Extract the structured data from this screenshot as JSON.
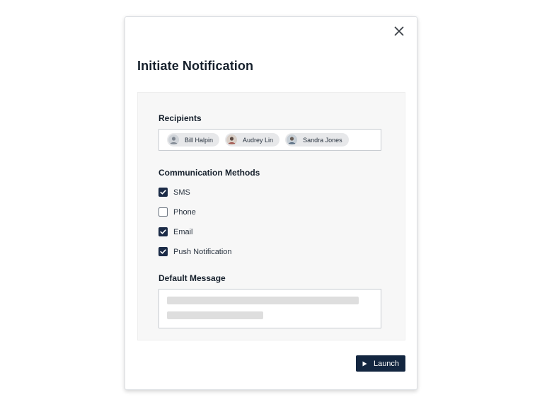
{
  "modal": {
    "title": "Initiate Notification",
    "close_icon": "close-icon"
  },
  "recipients": {
    "label": "Recipients",
    "chips": [
      {
        "name": "Bill Halpin",
        "icon": "avatar"
      },
      {
        "name": "Audrey Lin",
        "icon": "avatar"
      },
      {
        "name": "Sandra Jones",
        "icon": "avatar"
      }
    ]
  },
  "methods": {
    "label": "Communication Methods",
    "options": [
      {
        "label": "SMS",
        "checked": true
      },
      {
        "label": "Phone",
        "checked": false
      },
      {
        "label": "Email",
        "checked": true
      },
      {
        "label": "Push Notification",
        "checked": true
      }
    ]
  },
  "message": {
    "label": "Default Message",
    "value": ""
  },
  "actions": {
    "launch_label": "Launch",
    "launch_icon": "play-icon"
  },
  "colors": {
    "primary": "#132640",
    "checkbox_checked": "#1b2b47",
    "panel_bg": "#f7f7f7"
  }
}
